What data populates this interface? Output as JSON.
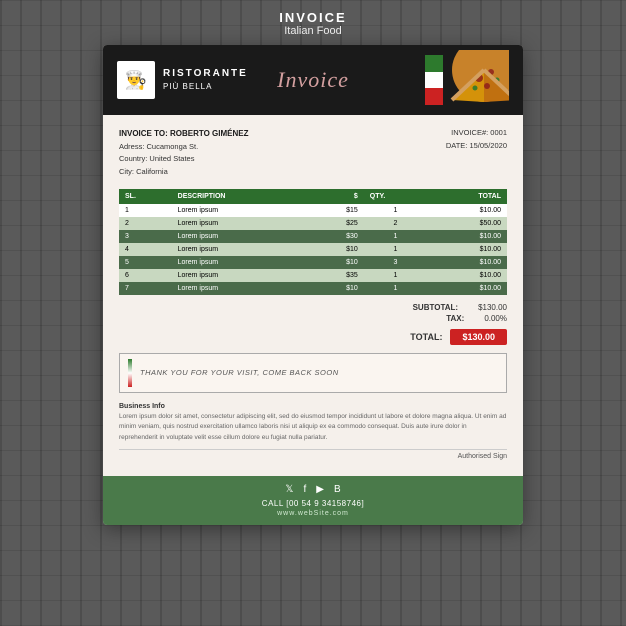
{
  "page": {
    "title": "INVOICE",
    "subtitle": "Italian Food"
  },
  "header": {
    "restaurant_line1": "RISTORANTE",
    "restaurant_line2": "PIÙ BELLA",
    "invoice_script": "Invoice"
  },
  "billing": {
    "bill_to_label": "INVOICE TO: ROBERTO GIMÉNEZ",
    "address": "Adress: Cucamonga St.",
    "country": "Country: United States",
    "city": "City: California",
    "invoice_num_label": "INVOICE#: 0001",
    "date_label": "DATE: 15/05/2020"
  },
  "table": {
    "headers": [
      "SL.",
      "DESCRIPTION",
      "$",
      "QTY.",
      "TOTAL"
    ],
    "rows": [
      {
        "sl": "1",
        "desc": "Lorem ipsum",
        "price": "$15",
        "qty": "1",
        "total": "$10.00",
        "dark": false
      },
      {
        "sl": "2",
        "desc": "Lorem ipsum",
        "price": "$25",
        "qty": "2",
        "total": "$50.00",
        "dark": false
      },
      {
        "sl": "3",
        "desc": "Lorem ipsum",
        "price": "$30",
        "qty": "1",
        "total": "$10.00",
        "dark": true
      },
      {
        "sl": "4",
        "desc": "Lorem ipsum",
        "price": "$10",
        "qty": "1",
        "total": "$10.00",
        "dark": false
      },
      {
        "sl": "5",
        "desc": "Lorem ipsum",
        "price": "$10",
        "qty": "3",
        "total": "$10.00",
        "dark": true
      },
      {
        "sl": "6",
        "desc": "Lorem ipsum",
        "price": "$35",
        "qty": "1",
        "total": "$10.00",
        "dark": false
      },
      {
        "sl": "7",
        "desc": "Lorem ipsum",
        "price": "$10",
        "qty": "1",
        "total": "$10.00",
        "dark": true
      }
    ]
  },
  "totals": {
    "subtotal_label": "SUBTOTAL:",
    "subtotal_value": "$130.00",
    "tax_label": "TAX:",
    "tax_value": "0.00%",
    "total_label": "TOTAL:",
    "total_value": "$130.00"
  },
  "thankyou": {
    "message": "THANK YOU FOR YOUR VISIT, COME BACK SOON"
  },
  "business_info": {
    "label": "Business Info",
    "text": "Lorem ipsum dolor sit amet, consectetur adipiscing elit, sed do eiusmod tempor incididunt ut labore et dolore magna aliqua. Ut enim ad minim veniam, quis nostrud exercitation ullamco laboris nisi ut aliquip ex ea commodo consequat. Duis aute irure dolor in reprehenderit in voluptate velit esse cillum dolore eu fugiat nulla pariatur."
  },
  "auth": {
    "label": "Authorised Sign"
  },
  "footer": {
    "social": [
      "𝕏",
      "f",
      "▶",
      "B"
    ],
    "call_label": "CALL",
    "call_number": "[00 54 9 34158746]",
    "website": "www.webSite.com"
  }
}
